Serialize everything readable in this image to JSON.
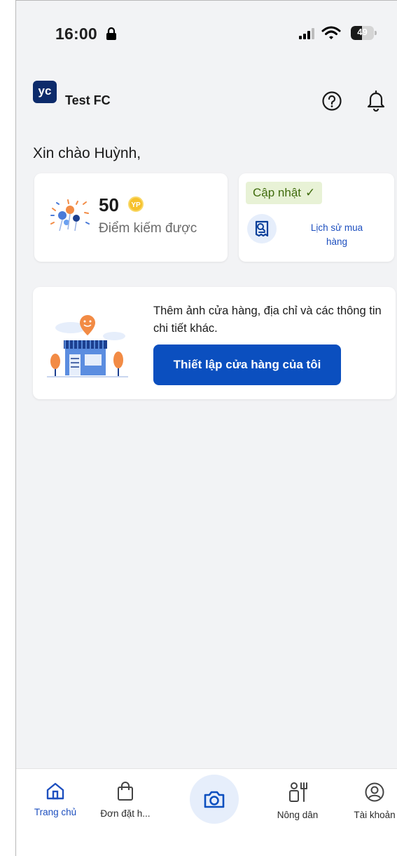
{
  "status_bar": {
    "time": "16:00",
    "battery_level": "49",
    "battery_fraction": 0.49
  },
  "header": {
    "logo_text": "yc",
    "store_name": "Test FC",
    "help_icon": "question-circle-icon",
    "notification_icon": "bell-icon"
  },
  "greeting": "Xin chào Huỳnh,",
  "points_card": {
    "value": "50",
    "coin_text": "YP",
    "label": "Điểm kiếm được"
  },
  "history_card": {
    "update_label": "Cập nhật",
    "check_glyph": "✓",
    "link_line1": "Lịch sử mua",
    "link_line2": "hàng"
  },
  "setup_card": {
    "description": "Thêm ảnh cửa hàng, địa chỉ và các thông tin chi tiết khác.",
    "button_label": "Thiết lập cửa hàng của tôi"
  },
  "bottom_nav": {
    "items": [
      {
        "label": "Trang chủ",
        "icon": "home-icon",
        "active": true
      },
      {
        "label": "Đơn đặt h...",
        "icon": "shopping-bag-icon",
        "active": false
      },
      {
        "label": "",
        "icon": "camera-icon",
        "active": false
      },
      {
        "label": "Nông dân",
        "icon": "farmer-icon",
        "active": false
      },
      {
        "label": "Tài khoản",
        "icon": "account-icon",
        "active": false
      }
    ]
  },
  "colors": {
    "primary": "#0b4fbf",
    "link": "#1d4fbf",
    "logo_bg": "#0d2b6b",
    "badge_bg": "#e8f2d6",
    "badge_text": "#3f6b0c",
    "background": "#f2f3f5"
  }
}
